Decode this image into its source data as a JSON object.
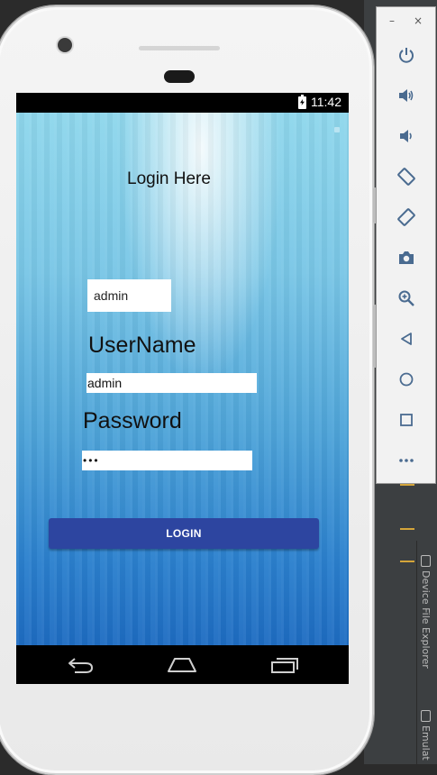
{
  "device": {
    "status_bar": {
      "time": "11:42"
    },
    "app": {
      "title": "Login Here",
      "echo_box_text": "admin",
      "username_label": "UserName",
      "username_value": "admin",
      "password_label": "Password",
      "password_value": "•••",
      "login_button": "LOGIN"
    },
    "nav_buttons": [
      "back-icon",
      "home-icon",
      "recents-icon"
    ]
  },
  "emulator_panel": {
    "window_controls": [
      "–",
      "×"
    ],
    "buttons": [
      "power-icon",
      "volume-up-icon",
      "volume-down-icon",
      "rotate-left-icon",
      "rotate-right-icon",
      "camera-icon",
      "zoom-in-icon",
      "back-icon",
      "home-icon",
      "overview-icon",
      "more-icon"
    ]
  },
  "ide_side_tabs": {
    "device_file_explorer": "Device File Explorer",
    "emulator": "Emulat"
  },
  "colors": {
    "accent_button": "#2d45a0",
    "panel_icon": "#4a6b90",
    "ide_background": "#3c3f41",
    "ide_marker": "#d4a53a"
  }
}
